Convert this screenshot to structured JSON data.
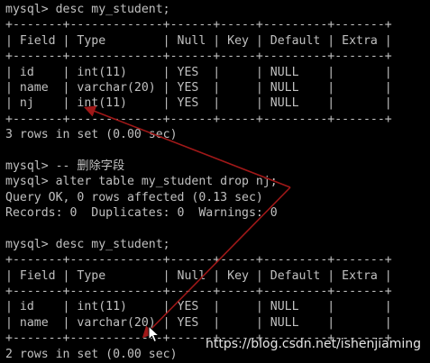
{
  "terminal": {
    "lines": [
      "mysql> desc my_student;",
      "+-------+-------------+------+-----+---------+-------+",
      "| Field | Type        | Null | Key | Default | Extra |",
      "+-------+-------------+------+-----+---------+-------+",
      "| id    | int(11)     | YES  |     | NULL    |       |",
      "| name  | varchar(20) | YES  |     | NULL    |       |",
      "| nj    | int(11)     | YES  |     | NULL    |       |",
      "+-------+-------------+------+-----+---------+-------+",
      "3 rows in set (0.00 sec)",
      "",
      "mysql> -- 删除字段",
      "mysql> alter table my_student drop nj;",
      "Query OK, 0 rows affected (0.13 sec)",
      "Records: 0  Duplicates: 0  Warnings: 0",
      "",
      "mysql> desc my_student;",
      "+-------+-------------+------+-----+---------+-------+",
      "| Field | Type        | Null | Key | Default | Extra |",
      "+-------+-------------+------+-----+---------+-------+",
      "| id    | int(11)     | YES  |     | NULL    |       |",
      "| name  | varchar(20) | YES  |     | NULL    |       |",
      "+-------+-------------+------+-----+---------+-------+",
      "2 rows in set (0.00 sec)"
    ]
  },
  "annotations": {
    "arrow_color": "#a01818",
    "arrow_1": "from the drop nj command up to the nj row",
    "arrow_2": "from the drop nj command down to the second result table"
  },
  "cursor": {
    "icon": "mouse-pointer-icon"
  },
  "watermark": {
    "text": "https://blog.csdn.net/ishenjiaming"
  },
  "colors": {
    "background": "#000000",
    "text": "#c0c0c0"
  }
}
